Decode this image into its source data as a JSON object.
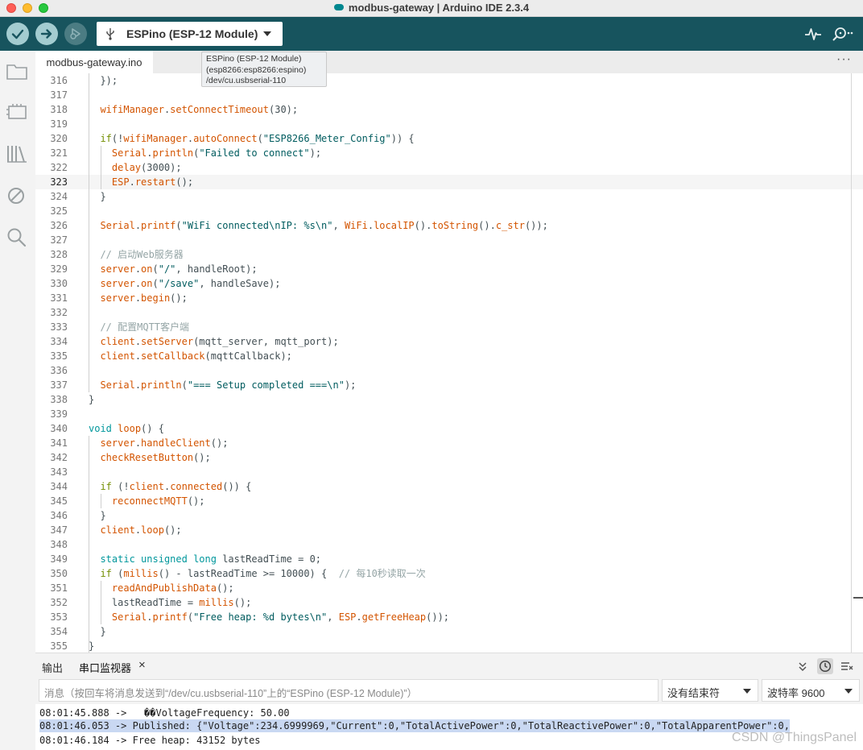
{
  "window": {
    "title": "modbus-gateway | Arduino IDE 2.3.4"
  },
  "toolbar": {
    "verify_icon": "check-icon",
    "upload_icon": "arrow-right-icon",
    "debug_icon": "debug-icon",
    "board_label": "ESPino (ESP-12 Module)",
    "serial_plotter_icon": "pulse-icon",
    "serial_monitor_icon": "magnifier-dots-icon"
  },
  "tooltip": {
    "line1": "ESPino (ESP-12 Module)",
    "line2": "(esp8266:esp8266:espino)",
    "line3": "/dev/cu.usbserial-110"
  },
  "editor_tab": {
    "label": "modbus-gateway.ino",
    "more": "···"
  },
  "sidebar": {
    "items": [
      "folder-icon",
      "board-manager-icon",
      "library-icon",
      "debug-disabled-icon",
      "search-icon"
    ]
  },
  "editor": {
    "highlight_line": 323,
    "lines": [
      {
        "n": "316",
        "t": "  });"
      },
      {
        "n": "317",
        "t": ""
      },
      {
        "n": "318",
        "t": "  wifiManager.setConnectTimeout(30);"
      },
      {
        "n": "319",
        "t": ""
      },
      {
        "n": "320",
        "t": "  if(!wifiManager.autoConnect(\"ESP8266_Meter_Config\")) {"
      },
      {
        "n": "321",
        "t": "    Serial.println(\"Failed to connect\");"
      },
      {
        "n": "322",
        "t": "    delay(3000);"
      },
      {
        "n": "323",
        "t": "    ESP.restart();"
      },
      {
        "n": "324",
        "t": "  }"
      },
      {
        "n": "325",
        "t": ""
      },
      {
        "n": "326",
        "t": "  Serial.printf(\"WiFi connected\\nIP: %s\\n\", WiFi.localIP().toString().c_str());"
      },
      {
        "n": "327",
        "t": ""
      },
      {
        "n": "328",
        "t": "  // 启动Web服务器"
      },
      {
        "n": "329",
        "t": "  server.on(\"/\", handleRoot);"
      },
      {
        "n": "330",
        "t": "  server.on(\"/save\", handleSave);"
      },
      {
        "n": "331",
        "t": "  server.begin();"
      },
      {
        "n": "332",
        "t": ""
      },
      {
        "n": "333",
        "t": "  // 配置MQTT客户端"
      },
      {
        "n": "334",
        "t": "  client.setServer(mqtt_server, mqtt_port);"
      },
      {
        "n": "335",
        "t": "  client.setCallback(mqttCallback);"
      },
      {
        "n": "336",
        "t": ""
      },
      {
        "n": "337",
        "t": "  Serial.println(\"=== Setup completed ===\\n\");"
      },
      {
        "n": "338",
        "t": "}"
      },
      {
        "n": "339",
        "t": ""
      },
      {
        "n": "340",
        "t": "void loop() {"
      },
      {
        "n": "341",
        "t": "  server.handleClient();"
      },
      {
        "n": "342",
        "t": "  checkResetButton();"
      },
      {
        "n": "343",
        "t": ""
      },
      {
        "n": "344",
        "t": "  if (!client.connected()) {"
      },
      {
        "n": "345",
        "t": "    reconnectMQTT();"
      },
      {
        "n": "346",
        "t": "  }"
      },
      {
        "n": "347",
        "t": "  client.loop();"
      },
      {
        "n": "348",
        "t": ""
      },
      {
        "n": "349",
        "t": "  static unsigned long lastReadTime = 0;"
      },
      {
        "n": "350",
        "t": "  if (millis() - lastReadTime >= 10000) {  // 每10秒读取一次"
      },
      {
        "n": "351",
        "t": "    readAndPublishData();"
      },
      {
        "n": "352",
        "t": "    lastReadTime = millis();"
      },
      {
        "n": "353",
        "t": "    Serial.printf(\"Free heap: %d bytes\\n\", ESP.getFreeHeap());"
      },
      {
        "n": "354",
        "t": "  }"
      },
      {
        "n": "355",
        "t": "}"
      }
    ]
  },
  "bottom_panel": {
    "tab_output": "输出",
    "tab_serial": "串口监视器",
    "close_glyph": "×",
    "collapse_icon": "double-chevron-down-icon",
    "timestamp_icon": "clock-icon",
    "clear_icon": "clear-output-icon",
    "message_placeholder": "消息（按回车将消息发送到“/dev/cu.usbserial-110”上的“ESPino (ESP-12 Module)”）",
    "line_ending": "没有结束符",
    "baud_rate": "波特率 9600",
    "serial_lines": [
      "08:01:45.888 ->   ��VoltageFrequency: 50.00",
      "08:01:46.053 -> Published: {\"Voltage\":234.6999969,\"Current\":0,\"TotalActivePower\":0,\"TotalReactivePower\":0,\"TotalApparentPower\":0,",
      "08:01:46.184 -> Free heap: 43152 bytes"
    ]
  },
  "watermark": "CSDN @ThingsPanel"
}
